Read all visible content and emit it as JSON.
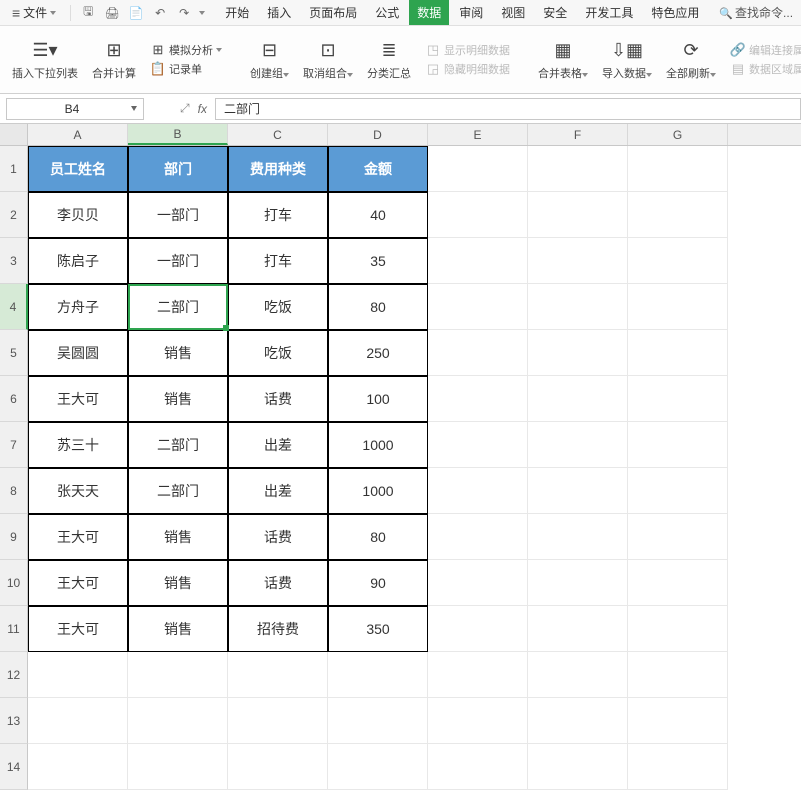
{
  "menubar": {
    "file": "文件",
    "tabs": [
      "开始",
      "插入",
      "页面布局",
      "公式",
      "数据",
      "审阅",
      "视图",
      "安全",
      "开发工具",
      "特色应用"
    ],
    "active_tab_index": 4,
    "search": "查找命令..."
  },
  "ribbon": {
    "insert_dropdown": "插入下拉列表",
    "merge_calc": "合并计算",
    "simulate": "模拟分析",
    "record": "记录单",
    "create_group": "创建组",
    "ungroup": "取消组合",
    "subtotal": "分类汇总",
    "show_detail": "显示明细数据",
    "hide_detail": "隐藏明细数据",
    "merge_table": "合并表格",
    "import_data": "导入数据",
    "refresh_all": "全部刷新",
    "edit_conn": "编辑连接属性",
    "data_area": "数据区域属性"
  },
  "formula": {
    "cell_ref": "B4",
    "fx": "fx",
    "value": "二部门",
    "expand_icon": "⤢"
  },
  "columns": [
    "A",
    "B",
    "C",
    "D",
    "E",
    "F",
    "G"
  ],
  "active": {
    "row": 4,
    "col": 1
  },
  "table": {
    "headers": [
      "员工姓名",
      "部门",
      "费用种类",
      "金额"
    ],
    "rows": [
      [
        "李贝贝",
        "一部门",
        "打车",
        "40"
      ],
      [
        "陈启子",
        "一部门",
        "打车",
        "35"
      ],
      [
        "方舟子",
        "二部门",
        "吃饭",
        "80"
      ],
      [
        "吴圆圆",
        "销售",
        "吃饭",
        "250"
      ],
      [
        "王大可",
        "销售",
        "话费",
        "100"
      ],
      [
        "苏三十",
        "二部门",
        "出差",
        "1000"
      ],
      [
        "张天天",
        "二部门",
        "出差",
        "1000"
      ],
      [
        "王大可",
        "销售",
        "话费",
        "80"
      ],
      [
        "王大可",
        "销售",
        "话费",
        "90"
      ],
      [
        "王大可",
        "销售",
        "招待费",
        "350"
      ]
    ]
  },
  "row_numbers": [
    1,
    2,
    3,
    4,
    5,
    6,
    7,
    8,
    9,
    10,
    11,
    12,
    13,
    14
  ]
}
